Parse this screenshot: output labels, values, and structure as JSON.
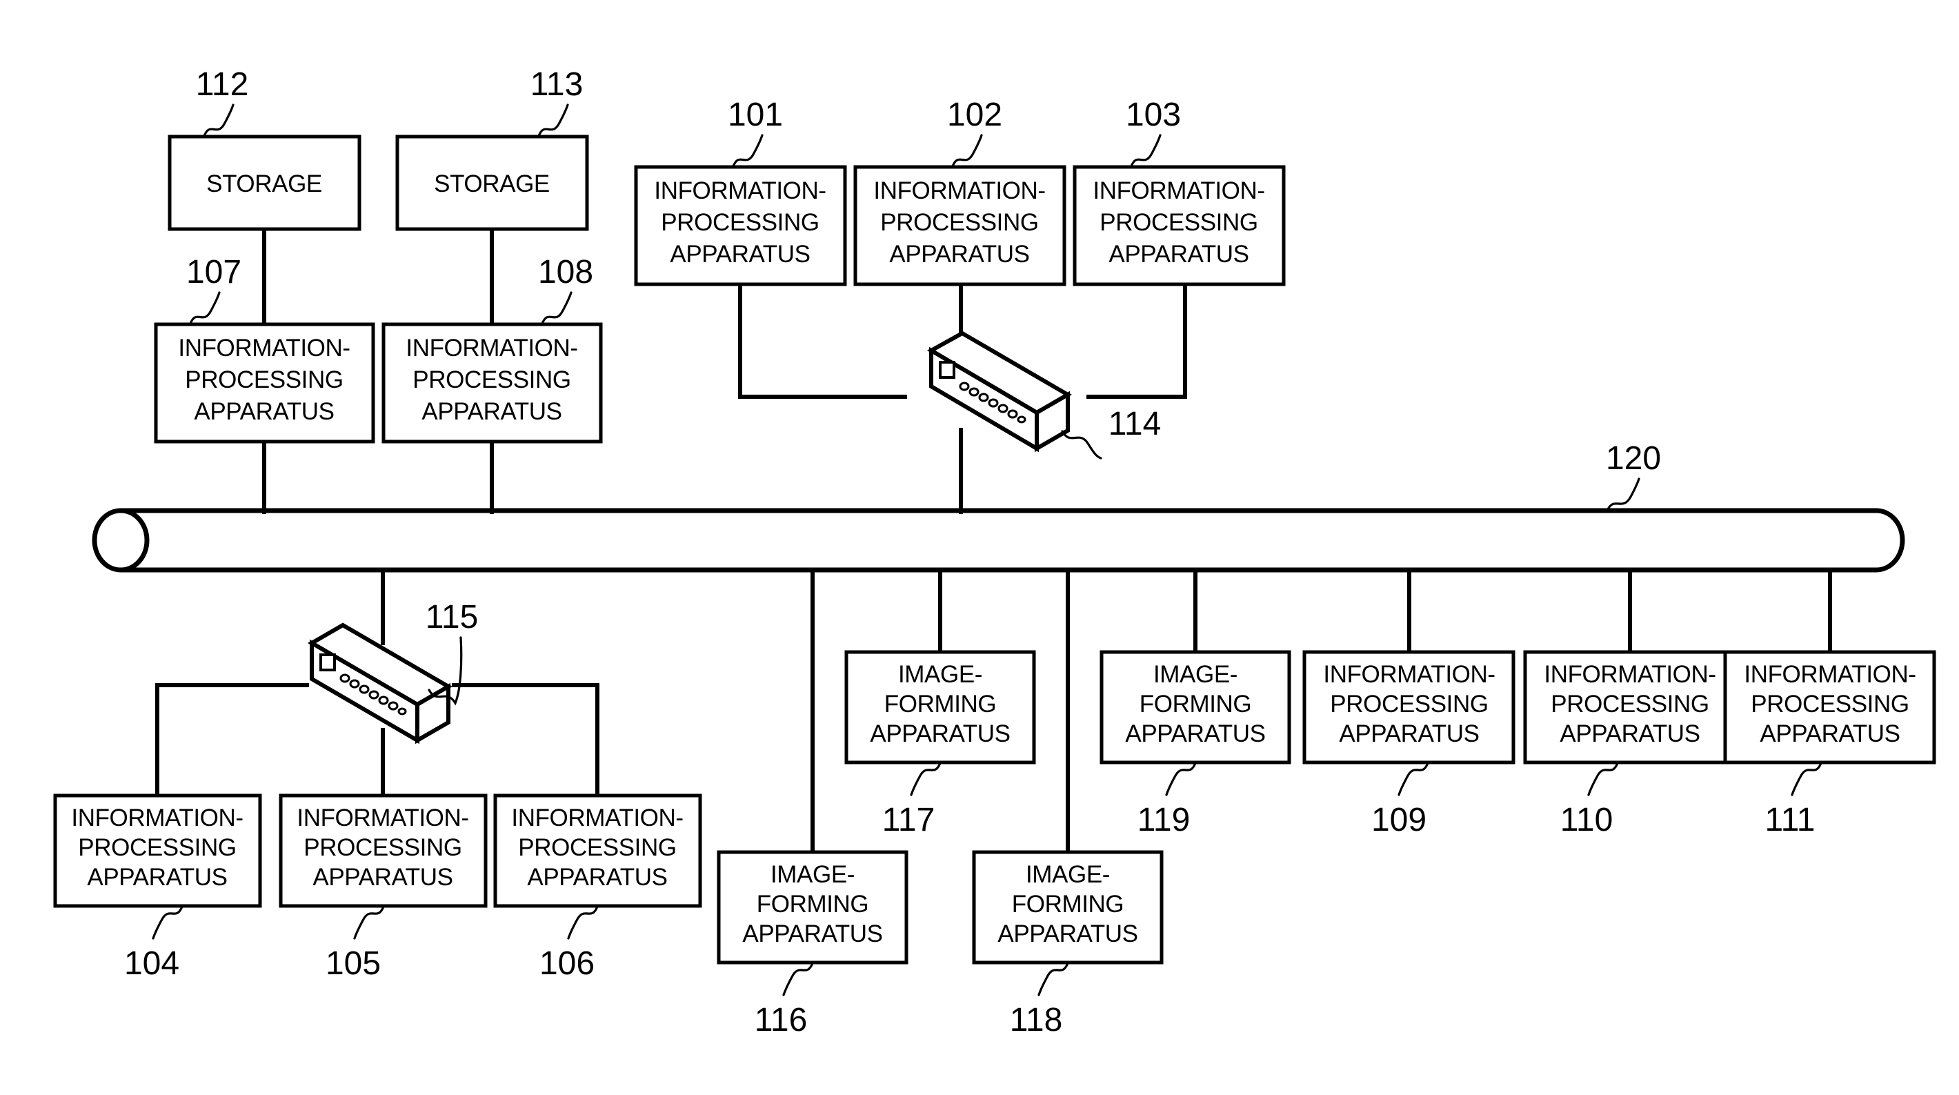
{
  "figure": {
    "title": "Network system block diagram",
    "background_color": "#ffffff",
    "line_color": "#000000"
  },
  "labels": {
    "storage": "STORAGE",
    "information_processing_apparatus": [
      "INFORMATION-",
      "PROCESSING",
      "APPARATUS"
    ],
    "image_forming_apparatus": [
      "IMAGE-",
      "FORMING",
      "APPARATUS"
    ]
  },
  "nodes": [
    {
      "id": "n112",
      "ref": "112",
      "type": "storage",
      "lines": [
        "STORAGE"
      ]
    },
    {
      "id": "n113",
      "ref": "113",
      "type": "storage",
      "lines": [
        "STORAGE"
      ]
    },
    {
      "id": "n107",
      "ref": "107",
      "type": "information-processing-apparatus",
      "lines": [
        "INFORMATION-",
        "PROCESSING",
        "APPARATUS"
      ]
    },
    {
      "id": "n108",
      "ref": "108",
      "type": "information-processing-apparatus",
      "lines": [
        "INFORMATION-",
        "PROCESSING",
        "APPARATUS"
      ]
    },
    {
      "id": "n101",
      "ref": "101",
      "type": "information-processing-apparatus",
      "lines": [
        "INFORMATION-",
        "PROCESSING",
        "APPARATUS"
      ]
    },
    {
      "id": "n102",
      "ref": "102",
      "type": "information-processing-apparatus",
      "lines": [
        "INFORMATION-",
        "PROCESSING",
        "APPARATUS"
      ]
    },
    {
      "id": "n103",
      "ref": "103",
      "type": "information-processing-apparatus",
      "lines": [
        "INFORMATION-",
        "PROCESSING",
        "APPARATUS"
      ]
    },
    {
      "id": "n104",
      "ref": "104",
      "type": "information-processing-apparatus",
      "lines": [
        "INFORMATION-",
        "PROCESSING",
        "APPARATUS"
      ]
    },
    {
      "id": "n105",
      "ref": "105",
      "type": "information-processing-apparatus",
      "lines": [
        "INFORMATION-",
        "PROCESSING",
        "APPARATUS"
      ]
    },
    {
      "id": "n106",
      "ref": "106",
      "type": "information-processing-apparatus",
      "lines": [
        "INFORMATION-",
        "PROCESSING",
        "APPARATUS"
      ]
    },
    {
      "id": "n116",
      "ref": "116",
      "type": "image-forming-apparatus",
      "lines": [
        "IMAGE-",
        "FORMING",
        "APPARATUS"
      ]
    },
    {
      "id": "n117",
      "ref": "117",
      "type": "image-forming-apparatus",
      "lines": [
        "IMAGE-",
        "FORMING",
        "APPARATUS"
      ]
    },
    {
      "id": "n118",
      "ref": "118",
      "type": "image-forming-apparatus",
      "lines": [
        "IMAGE-",
        "FORMING",
        "APPARATUS"
      ]
    },
    {
      "id": "n119",
      "ref": "119",
      "type": "image-forming-apparatus",
      "lines": [
        "IMAGE-",
        "FORMING",
        "APPARATUS"
      ]
    },
    {
      "id": "n109",
      "ref": "109",
      "type": "information-processing-apparatus",
      "lines": [
        "INFORMATION-",
        "PROCESSING",
        "APPARATUS"
      ]
    },
    {
      "id": "n110",
      "ref": "110",
      "type": "information-processing-apparatus",
      "lines": [
        "INFORMATION-",
        "PROCESSING",
        "APPARATUS"
      ]
    },
    {
      "id": "n111",
      "ref": "111",
      "type": "information-processing-apparatus",
      "lines": [
        "INFORMATION-",
        "PROCESSING",
        "APPARATUS"
      ]
    },
    {
      "id": "n114",
      "ref": "114",
      "type": "network-switch",
      "lines": []
    },
    {
      "id": "n115",
      "ref": "115",
      "type": "network-switch",
      "lines": []
    },
    {
      "id": "n120",
      "ref": "120",
      "type": "network-bus",
      "lines": []
    }
  ],
  "refs": {
    "r112": "112",
    "r113": "113",
    "r107": "107",
    "r108": "108",
    "r101": "101",
    "r102": "102",
    "r103": "103",
    "r114": "114",
    "r115": "115",
    "r104": "104",
    "r105": "105",
    "r106": "106",
    "r116": "116",
    "r117": "117",
    "r118": "118",
    "r119": "119",
    "r109": "109",
    "r110": "110",
    "r111": "111",
    "r120": "120"
  },
  "text_lines": {
    "storage": "STORAGE",
    "ipa1": "INFORMATION-",
    "ipa2": "PROCESSING",
    "ipa3": "APPARATUS",
    "ifa1": "IMAGE-",
    "ifa2": "FORMING",
    "ifa3": "APPARATUS"
  }
}
